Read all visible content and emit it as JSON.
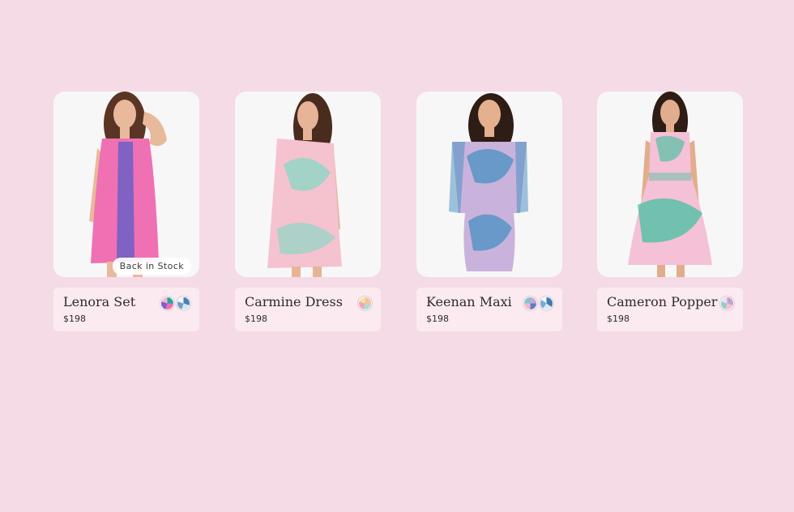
{
  "products": [
    {
      "name": "Lenora Set",
      "price": "$198",
      "badge": "Back in Stock",
      "colors": {
        "dress": "#f070b4",
        "pattern": "#6b5fc4",
        "hair": "#5a3524",
        "skin": "#e9b99c"
      },
      "swatch_icons": [
        "swatch-pink-green-print-icon",
        "swatch-blue-white-print-icon"
      ]
    },
    {
      "name": "Carmine Dress",
      "price": "$198",
      "colors": {
        "dress": "#f5c2cf",
        "pattern": "#8fd6c4",
        "hair": "#4a2c1e",
        "skin": "#e7b497"
      },
      "swatch_icons": [
        "swatch-multicolor-print-icon"
      ]
    },
    {
      "name": "Keenan Maxi",
      "price": "$198",
      "colors": {
        "dress": "#c9b3dc",
        "pattern": "#3f8ec0",
        "hair": "#2e1d15",
        "skin": "#e4b08e"
      },
      "swatch_icons": [
        "swatch-lilac-print-icon",
        "swatch-blue-white-print-icon"
      ]
    },
    {
      "name": "Cameron Popper",
      "price": "$198",
      "colors": {
        "dress": "#f4c1d6",
        "pattern": "#3bbf9c",
        "hair": "#2e1d15",
        "skin": "#e2ad8c"
      },
      "swatch_icons": [
        "swatch-pastel-print-icon"
      ]
    }
  ]
}
